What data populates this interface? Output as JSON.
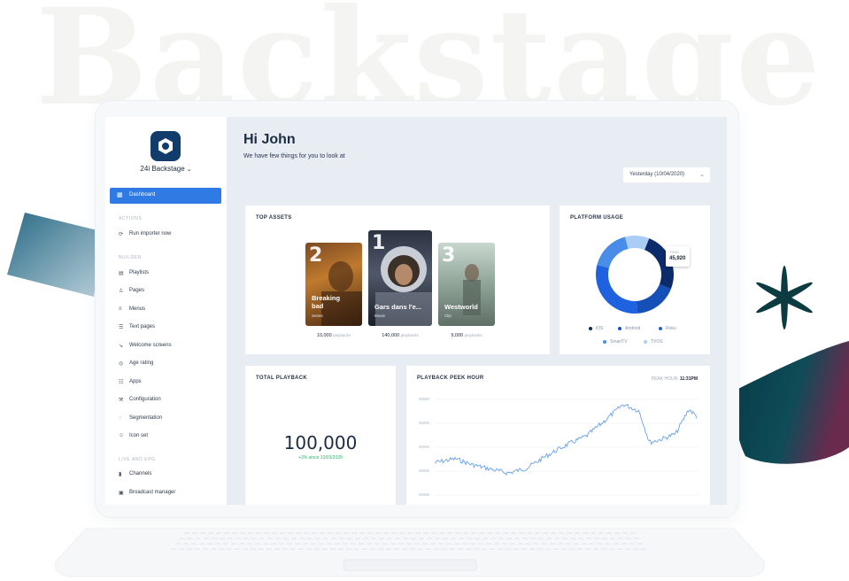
{
  "background_word": "Backstage",
  "sidebar": {
    "brand": "24i Backstage",
    "active_item": {
      "label": "Dashboard",
      "icon": "dashboard-icon"
    },
    "sections": [
      {
        "title": "ACTIONS",
        "items": [
          {
            "label": "Run importer now",
            "icon": "sync-icon"
          }
        ]
      },
      {
        "title": "BUILDER",
        "items": [
          {
            "label": "Playlists",
            "icon": "playlist-icon"
          },
          {
            "label": "Pages",
            "icon": "pages-icon"
          },
          {
            "label": "Menus",
            "icon": "menu-icon"
          },
          {
            "label": "Text pages",
            "icon": "text-icon"
          },
          {
            "label": "Welcome screens",
            "icon": "welcome-icon"
          },
          {
            "label": "Age rating",
            "icon": "age-rating-icon"
          },
          {
            "label": "Apps",
            "icon": "apps-icon"
          },
          {
            "label": "Configuration",
            "icon": "wrench-icon"
          },
          {
            "label": "Segmentation",
            "icon": "segmentation-icon"
          },
          {
            "label": "Icon set",
            "icon": "icon-set-icon"
          }
        ]
      },
      {
        "title": "LIVE AND EPG",
        "items": [
          {
            "label": "Channels",
            "icon": "channels-icon"
          },
          {
            "label": "Broadcast manager",
            "icon": "calendar-icon"
          }
        ]
      }
    ]
  },
  "header": {
    "greeting": "Hi John",
    "subtitle": "We have few things for you to look at",
    "date_select": "Yesterday (10/04/2020)"
  },
  "top_assets": {
    "title": "TOP ASSETS",
    "unit": "playbacks",
    "items": [
      {
        "rank": "2",
        "title": "Breaking bad",
        "type": "Series",
        "plays": "10,000"
      },
      {
        "rank": "1",
        "title": "Gars dans l'e...",
        "type": "Movie",
        "plays": "140,000"
      },
      {
        "rank": "3",
        "title": "Westworld",
        "type": "Clip",
        "plays": "9,000"
      }
    ]
  },
  "platform_usage": {
    "title": "PLATFORM USAGE",
    "tooltip_label": "TVOS",
    "tooltip_value": "45,920",
    "legend": [
      {
        "name": "iOS",
        "color": "#0b2b6a"
      },
      {
        "name": "Android",
        "color": "#154fb8"
      },
      {
        "name": "Roku",
        "color": "#1f62e0"
      },
      {
        "name": "SmartTV",
        "color": "#4a8de8"
      },
      {
        "name": "TVOS",
        "color": "#a9cdf5"
      }
    ],
    "slices": [
      {
        "name": "iOS",
        "value": 0.25
      },
      {
        "name": "Android",
        "value": 0.18
      },
      {
        "name": "Roku",
        "value": 0.3
      },
      {
        "name": "SmartTV",
        "value": 0.17
      },
      {
        "name": "TVOS",
        "value": 0.1
      }
    ]
  },
  "total_playback": {
    "title": "TOTAL PLAYBACK",
    "value": "100,000",
    "change": "+3% since 10/03/2020"
  },
  "playback_peak": {
    "title": "PLAYBACK PEEK HOUR",
    "peak_label": "PEAK HOUR:",
    "peak_time": "11:31PM"
  },
  "colors": {
    "accent": "#2f7ae5",
    "brand": "#123c6b",
    "growth": "#2eb46b"
  }
}
